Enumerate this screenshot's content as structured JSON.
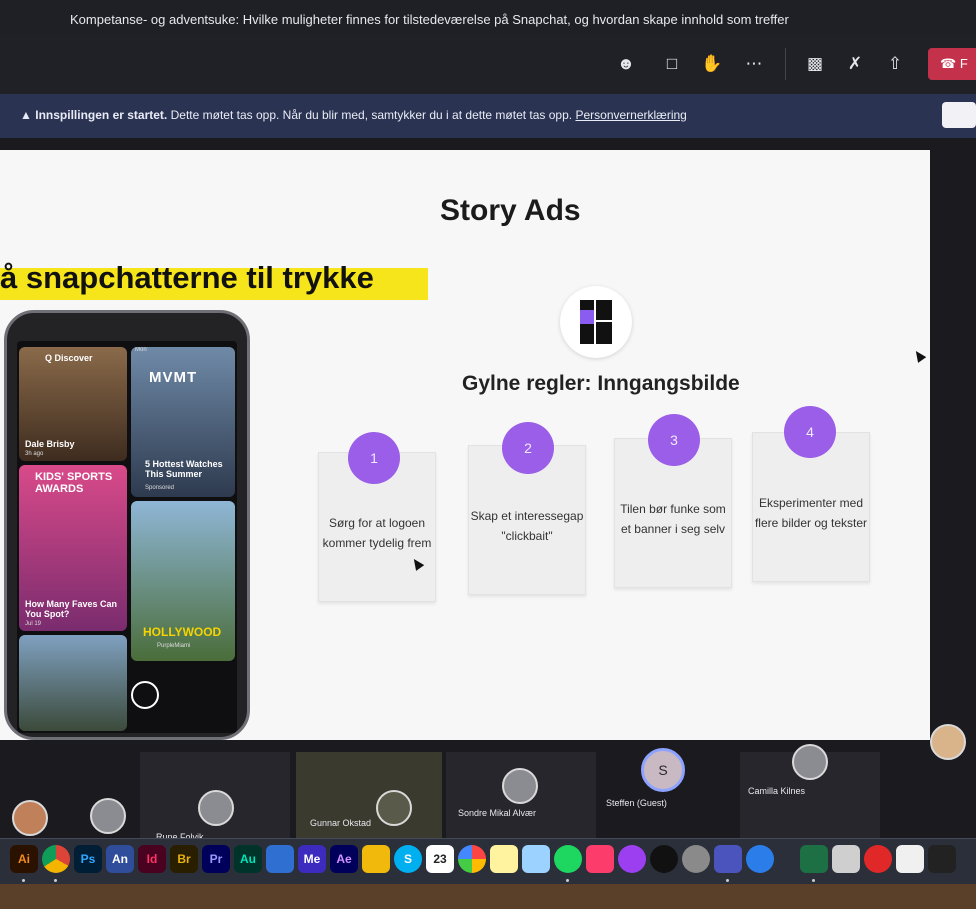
{
  "window": {
    "title": "Kompetanse- og adventsuke: Hvilke muligheter finnes for tilstedeværelse på Snapchat, og hvordan skape innhold som treffer"
  },
  "toolbar": {
    "icons": [
      "people-icon",
      "chat-icon",
      "raise-hand-icon",
      "more-icon",
      "camera-off-icon",
      "mic-off-icon",
      "share-screen-icon"
    ],
    "leave_label": "F"
  },
  "recording_banner": {
    "bold_text": "Innspillingen er startet.",
    "text": "Dette møtet tas opp. Når du blir med, samtykker du i at dette møtet tas opp.",
    "link_text": "Personvernerklæring"
  },
  "slide": {
    "title": "Story Ads",
    "headline": "å snapchatterne til trykke",
    "subtitle": "Gylne regler: Inngangsbilde",
    "steps": [
      {
        "num": "1",
        "text": "Sørg for at logoen kommer tydelig frem"
      },
      {
        "num": "2",
        "text": "Skap et interessegap \"clickbait\""
      },
      {
        "num": "3",
        "text": "Tilen bør funke som et banner i seg selv"
      },
      {
        "num": "4",
        "text": "Eksperimenter med flere bilder og tekster"
      }
    ],
    "phone": {
      "discover_label": "Q Discover",
      "tiles": {
        "dale": "Dale Brisby",
        "dale_sub": "3h ago",
        "mvmt": "MVMT",
        "kids": "KIDS' SPORTS AWARDS",
        "watches": "5 Hottest Watches This Summer",
        "watches_sub": "Sponsored",
        "faves": "How Many Faves Can You Spot?",
        "faves_sub": "Jul 19",
        "hollywood": "HOLLYWOOD",
        "purple": "PurpleMiami",
        "mon": "Mon"
      }
    }
  },
  "participants": [
    {
      "name": ""
    },
    {
      "name": ""
    },
    {
      "name": "Rune Folvik"
    },
    {
      "name": "Gunnar Okstad"
    },
    {
      "name": "Sondre Mikal Alvær"
    },
    {
      "name": "Steffen (Guest)"
    },
    {
      "name": "Camilla Kilnes"
    },
    {
      "name": ""
    }
  ],
  "active_speaker_initial": "S",
  "dock": {
    "icons": [
      {
        "label": "Ai",
        "color": "#f28a1e",
        "bg": "#2b1200"
      },
      {
        "label": "",
        "color": "#ffffff",
        "bg": "#ffffff"
      },
      {
        "label": "Ps",
        "color": "#31a8ff",
        "bg": "#001e36"
      },
      {
        "label": "An",
        "color": "#ffffff",
        "bg": "#2f4d9a"
      },
      {
        "label": "Id",
        "color": "#ff3366",
        "bg": "#49021f"
      },
      {
        "label": "Br",
        "color": "#e8b30a",
        "bg": "#2a1e00"
      },
      {
        "label": "Pr",
        "color": "#9999ff",
        "bg": "#00005b"
      },
      {
        "label": "Au",
        "color": "#00e4bb",
        "bg": "#00332a"
      },
      {
        "label": "",
        "color": "#ffffff",
        "bg": "#2e6fd1"
      },
      {
        "label": "Me",
        "color": "#ffffff",
        "bg": "#3d2bbf"
      },
      {
        "label": "Ae",
        "color": "#d291ff",
        "bg": "#00005b"
      },
      {
        "label": "",
        "color": "#ffffff",
        "bg": "#f0b90b"
      },
      {
        "label": "S",
        "color": "#ffffff",
        "bg": "#00aff0"
      },
      {
        "label": "23",
        "color": "#222222",
        "bg": "#ffffff"
      }
    ]
  }
}
